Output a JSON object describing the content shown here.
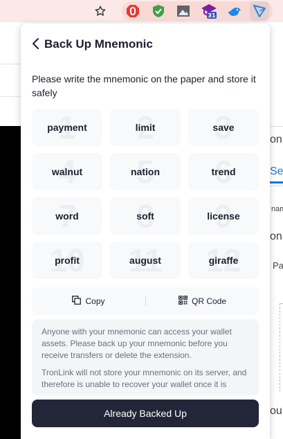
{
  "browser": {
    "extensions": [
      {
        "name": "adblock-icon",
        "color": "#e53935"
      },
      {
        "name": "shield-icon",
        "color": "#43a047"
      },
      {
        "name": "image-icon",
        "color": "#5f6368"
      },
      {
        "name": "graduation-cap-icon",
        "color": "#7b1fa2",
        "badge": "31"
      },
      {
        "name": "bird-icon",
        "color": "#1e88e5"
      },
      {
        "name": "tronlink-icon",
        "color": "#1e88e5"
      }
    ]
  },
  "background_page": {
    "fragments": [
      "on",
      "Ser",
      "nam",
      "on",
      "Pa",
      "ou"
    ],
    "accent": "#1a73e8"
  },
  "popup": {
    "title": "Back Up Mnemonic",
    "instruction": "Please write the mnemonic on the paper and store it safely",
    "words": [
      {
        "index": "1",
        "word": "payment"
      },
      {
        "index": "2",
        "word": "limit"
      },
      {
        "index": "3",
        "word": "save"
      },
      {
        "index": "4",
        "word": "walnut"
      },
      {
        "index": "5",
        "word": "nation"
      },
      {
        "index": "6",
        "word": "trend"
      },
      {
        "index": "7",
        "word": "word"
      },
      {
        "index": "8",
        "word": "soft"
      },
      {
        "index": "9",
        "word": "license"
      },
      {
        "index": "10",
        "word": "profit"
      },
      {
        "index": "11",
        "word": "august"
      },
      {
        "index": "12",
        "word": "giraffe"
      }
    ],
    "copy_label": "Copy",
    "qr_label": "QR Code",
    "notice_1": "Anyone with your mnemonic can access your wallet assets. Please back up your mnemonic before you receive transfers or delete the extension.",
    "notice_2": "TronLink will not store your mnemonic on its server, and therefore is unable to recover your wallet once it is",
    "confirm_label": "Already Backed Up",
    "colors": {
      "primary": "#222638",
      "cell_bg": "#f8f9fb",
      "notice_bg": "#f4f5f7"
    }
  }
}
